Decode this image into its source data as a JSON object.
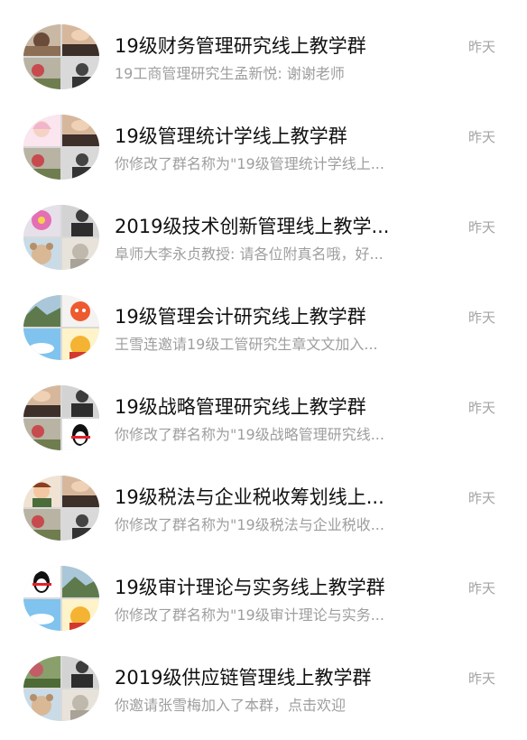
{
  "conversations": [
    {
      "title": "19级财务管理研究线上教学群",
      "time": "昨天",
      "preview": "19工商管理研究生孟新悦: 谢谢老师"
    },
    {
      "title": "19级管理统计学线上教学群",
      "time": "昨天",
      "preview": "你修改了群名称为\"19级管理统计学线上..."
    },
    {
      "title": "2019级技术创新管理线上教学...",
      "time": "昨天",
      "preview": "阜师大李永贞教授: 请各位附真名哦，好..."
    },
    {
      "title": "19级管理会计研究线上教学群",
      "time": "昨天",
      "preview": "王雪连邀请19级工管研究生章文文加入..."
    },
    {
      "title": "19级战略管理研究线上教学群",
      "time": "昨天",
      "preview": "你修改了群名称为\"19级战略管理研究线..."
    },
    {
      "title": "19级税法与企业税收筹划线上...",
      "time": "昨天",
      "preview": "你修改了群名称为\"19级税法与企业税收..."
    },
    {
      "title": "19级审计理论与实务线上教学群",
      "time": "昨天",
      "preview": "你修改了群名称为\"19级审计理论与实务..."
    },
    {
      "title": "2019级供应链管理线上教学群",
      "time": "昨天",
      "preview": "你邀请张雪梅加入了本群，点击欢迎"
    }
  ],
  "colors": {
    "accent": "#12b7f5",
    "title_text": "#111111",
    "secondary_text": "#9e9e9e"
  },
  "avatar_tiles": [
    [
      "avatar-photo",
      "sunset-photo",
      "flower-photo",
      "portrait-photo"
    ],
    [
      "cartoon-girl",
      "sunset-photo",
      "flower-photo",
      "portrait-photo"
    ],
    [
      "pink-flower",
      "portrait-photo",
      "bear-avatar",
      "sketch-avatar"
    ],
    [
      "landscape-photo",
      "fox-avatar",
      "sky-avatar",
      "pooh-avatar"
    ],
    [
      "sunset-photo",
      "portrait-photo",
      "flower-photo",
      "penguin-avatar"
    ],
    [
      "cartoon-boy",
      "sunset-photo",
      "flower-photo",
      "portrait-photo"
    ],
    [
      "penguin-avatar",
      "landscape-photo",
      "sky-avatar",
      "pooh-avatar"
    ],
    [
      "garden-photo",
      "portrait-photo",
      "bear-avatar",
      "sketch-avatar"
    ]
  ]
}
